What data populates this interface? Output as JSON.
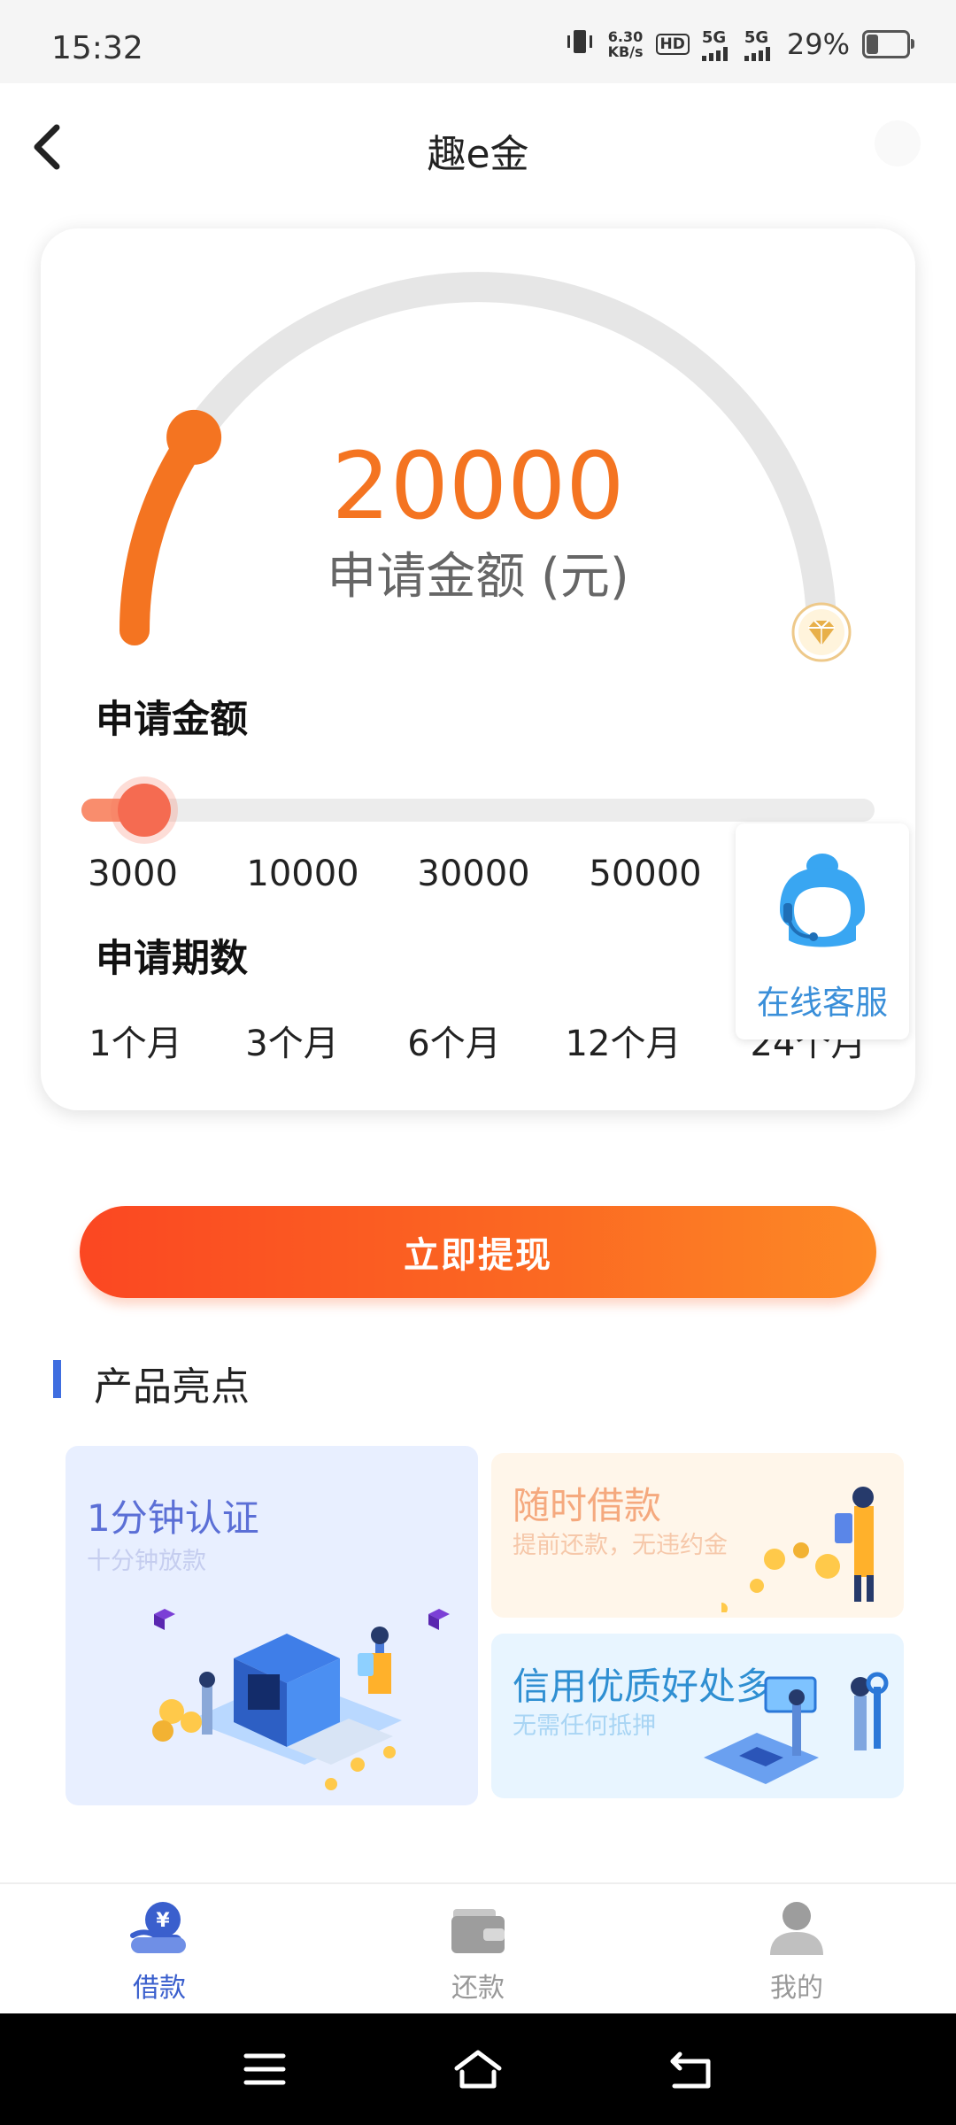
{
  "status_bar": {
    "time": "15:32",
    "net_speed_value": "6.30",
    "net_speed_unit": "KB/s",
    "hd_label": "HD",
    "net_type_1": "5G",
    "net_type_2": "5G",
    "battery_percent": "29%",
    "battery_level": 0.29
  },
  "header": {
    "title": "趣e金"
  },
  "loan": {
    "amount": "20000",
    "amount_caption": "申请金额 (元)",
    "gauge_fill_fraction": 0.19,
    "amount_section_label": "申请金额",
    "amount_slider_fraction": 0.065,
    "amount_ticks": [
      "3000",
      "10000",
      "30000",
      "50000"
    ],
    "term_section_label": "申请期数",
    "term_options": [
      "1个月",
      "3个月",
      "6个月",
      "12个月",
      "24个月"
    ]
  },
  "customer_service": {
    "label": "在线客服"
  },
  "cta": {
    "label": "立即提现"
  },
  "highlights": {
    "title": "产品亮点",
    "cards": [
      {
        "title": "1分钟认证",
        "subtitle": "十分钟放款"
      },
      {
        "title": "随时借款",
        "subtitle": "提前还款，无违约金"
      },
      {
        "title": "信用优质好处多",
        "subtitle": "无需任何抵押"
      }
    ]
  },
  "tabs": [
    {
      "label": "借款",
      "icon": "loan-icon",
      "active": true
    },
    {
      "label": "还款",
      "icon": "wallet-icon",
      "active": false
    },
    {
      "label": "我的",
      "icon": "profile-icon",
      "active": false
    }
  ],
  "colors": {
    "accent": "#f47421",
    "cta_start": "#fb4722",
    "cta_end": "#fd8a26",
    "active_tab": "#3a5fcd",
    "inactive_tab": "#999999",
    "cs_blue": "#3a8fd9"
  }
}
